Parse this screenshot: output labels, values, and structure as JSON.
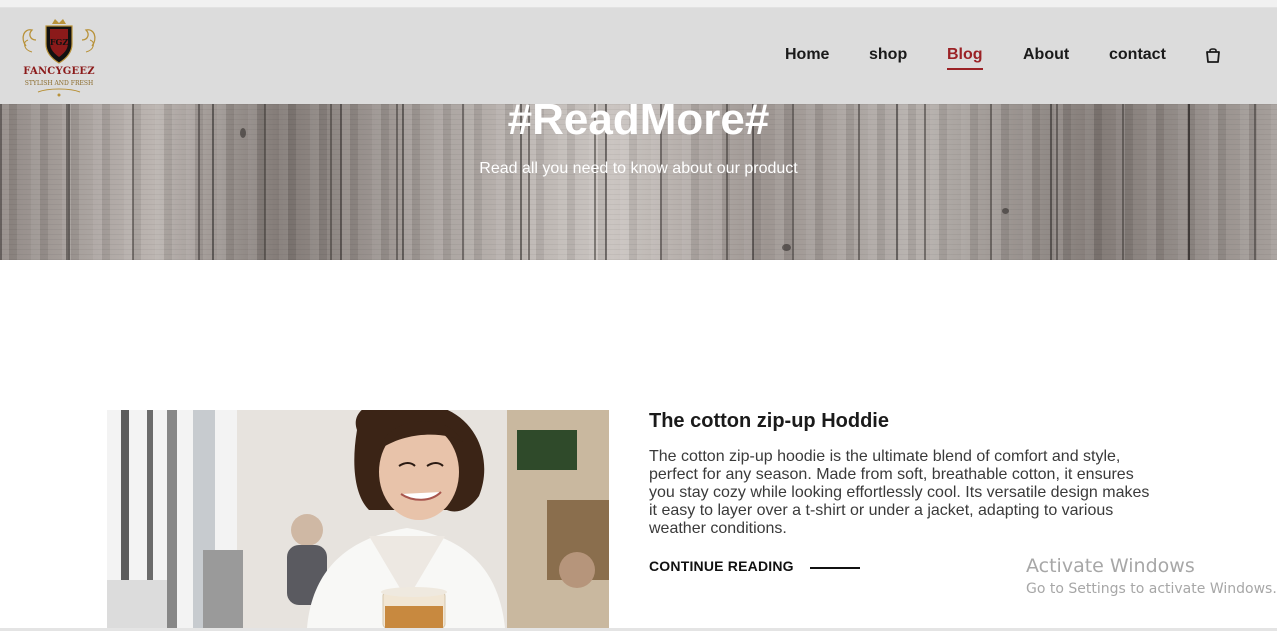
{
  "brand": {
    "logo_initials": "FGZ",
    "name": "FANCYGEEZ",
    "tagline": "STYLISH AND FRESH",
    "colors": {
      "primary": "#8b1a1a",
      "gold": "#b8923a"
    }
  },
  "nav": {
    "items": [
      {
        "label": "Home",
        "active": false
      },
      {
        "label": "shop",
        "active": false
      },
      {
        "label": "Blog",
        "active": true
      },
      {
        "label": "About",
        "active": false
      },
      {
        "label": "contact",
        "active": false
      }
    ],
    "cart_icon": "shopping-bag-icon",
    "active_color": "#9b2226"
  },
  "hero": {
    "title": "#ReadMore#",
    "subtitle": "Read all you need to know about our product"
  },
  "post": {
    "title": "The cotton zip-up Hoddie",
    "body": "The cotton zip-up hoodie is the ultimate blend of comfort and style, perfect for any season. Made from soft, breathable cotton, it ensures you stay cozy while looking effortlessly cool. Its versatile design makes it easy to layer over a t-shirt or under a jacket, adapting to various weather conditions.",
    "cta": "CONTINUE READING"
  },
  "os_watermark": {
    "title": "Activate Windows",
    "subtitle": "Go to Settings to activate Windows."
  }
}
